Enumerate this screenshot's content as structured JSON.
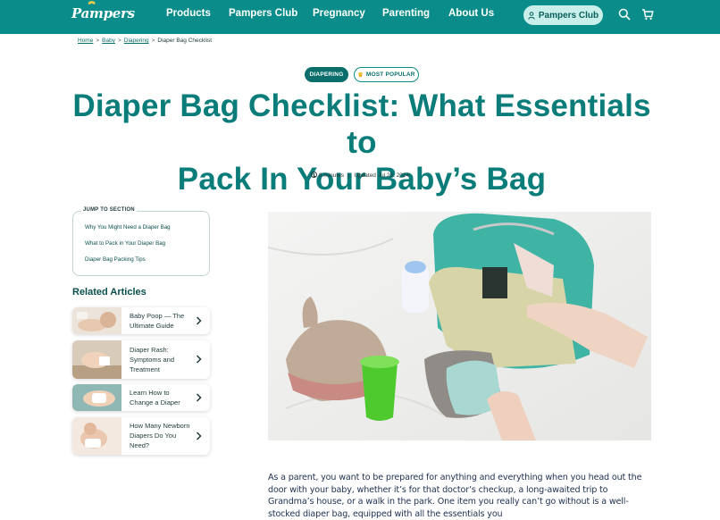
{
  "header": {
    "logo": "Pampers",
    "nav": [
      "Products",
      "Pampers Club",
      "Pregnancy",
      "Parenting",
      "About Us"
    ],
    "club_button": "Pampers Club",
    "colors": {
      "bar": "#0a8d8a",
      "club_button_bg": "#c8efe9"
    },
    "icons": [
      "search-icon",
      "cart-icon",
      "user-icon"
    ]
  },
  "breadcrumb": [
    "Home",
    "Baby",
    "Diapering",
    "Diaper Bag Checklist"
  ],
  "tags": {
    "category": "DIAPERING",
    "popular": "MOST POPULAR"
  },
  "article": {
    "title_line1": "Diaper Bag Checklist: What Essentials to",
    "title_line2": "Pack In Your Baby’s Bag",
    "read_time": "8 minutes",
    "updated": "Updated Jul 25, 2024",
    "body": "As a parent, you want to be prepared for anything and everything when you head out the door with your baby, whether it’s for that doctor’s checkup, a long-awaited trip to Grandma’s house, or a walk in the park. One item you really can’t go without is a well-stocked diaper bag, equipped with all the essentials you"
  },
  "jump": {
    "title": "JUMP TO SECTION",
    "links": [
      "Why You Might Need a Diaper Bag",
      "What to Pack in Your Diaper Bag",
      "Diaper Bag Packing Tips"
    ]
  },
  "related": {
    "title": "Related Articles",
    "items": [
      "Baby Poop — The Ultimate Guide",
      "Diaper Rash: Symptoms and Treatment",
      "Learn How to Change a Diaper",
      "How Many Newborn Diapers Do You Need?"
    ]
  }
}
